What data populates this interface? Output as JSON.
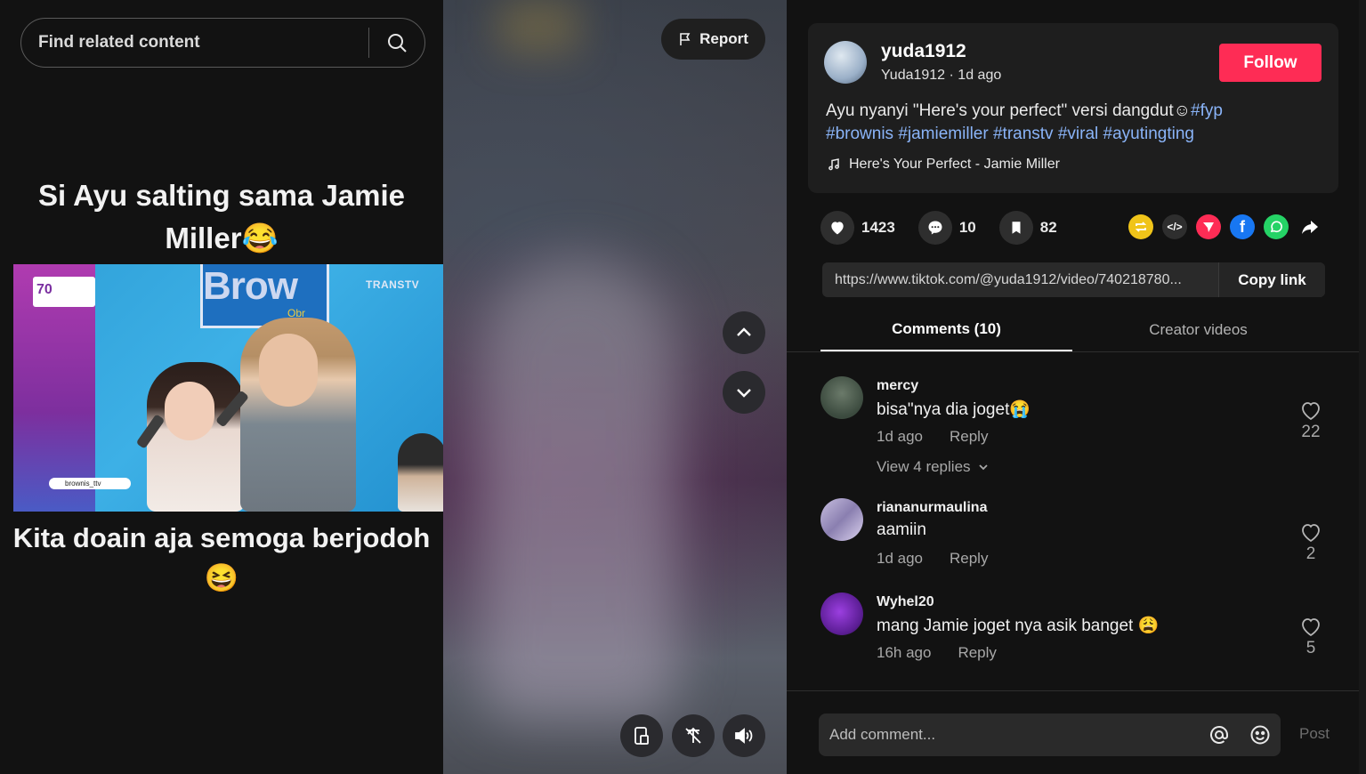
{
  "search": {
    "placeholder": "Find related content"
  },
  "video": {
    "caption_top": "Si Ayu salting sama Jamie Miller😂",
    "caption_bottom": "Kita doain aja semoga berjodoh😆",
    "clip_banner": "Brow",
    "clip_banner_sub": "Obr",
    "clip_channel": "TRANSTV",
    "clip_logo": "70",
    "clip_tag": "brownis_ttv"
  },
  "report": {
    "label": "Report"
  },
  "author": {
    "username": "yuda1912",
    "display": "Yuda1912 · 1d ago",
    "follow_label": "Follow"
  },
  "description": {
    "text": "Ayu nyanyi \"Here's your perfect\" versi dangdut☺",
    "tags": [
      "#fyp",
      "#brownis",
      "#jamiemiller",
      "#transtv",
      "#viral",
      "#ayutingting"
    ]
  },
  "music": {
    "title": "Here's Your Perfect - Jamie Miller"
  },
  "stats": {
    "likes": "1423",
    "comments": "10",
    "saves": "82"
  },
  "share": {
    "link": "https://www.tiktok.com/@yuda1912/video/740218780...",
    "copy_label": "Copy link"
  },
  "tabs": [
    {
      "label": "Comments (10)",
      "active": true
    },
    {
      "label": "Creator videos",
      "active": false
    }
  ],
  "comments": [
    {
      "user": "mercy",
      "text": "bisa\"nya dia joget😭",
      "time": "1d ago",
      "reply": "Reply",
      "likes": "22",
      "view_replies": "View 4 replies"
    },
    {
      "user": "riananurmaulina",
      "text": "aamiin",
      "time": "1d ago",
      "reply": "Reply",
      "likes": "2"
    },
    {
      "user": "Wyhel20",
      "text": "mang Jamie joget nya asik banget 😩",
      "time": "16h ago",
      "reply": "Reply",
      "likes": "5"
    }
  ],
  "comment_box": {
    "placeholder": "Add comment...",
    "post_label": "Post"
  },
  "colors": {
    "accent": "#fe2c55",
    "hashtag": "#8ab4f8"
  }
}
